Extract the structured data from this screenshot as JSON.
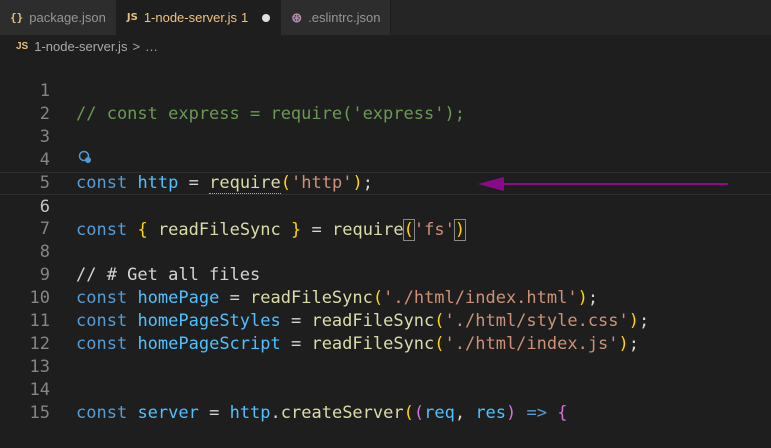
{
  "tabs": [
    {
      "icon": "{}",
      "label": "package.json"
    },
    {
      "icon": "JS",
      "label": "1-node-server.js",
      "error_count": "1"
    },
    {
      "icon": "⊛",
      "label": ".eslintrc.json"
    }
  ],
  "breadcrumb": {
    "icon": "JS",
    "file": "1-node-server.js",
    "sep": ">",
    "more": "…"
  },
  "lines": {
    "l1": {
      "num": "1",
      "comment": "// const express = require('express');"
    },
    "l2": {
      "num": "2"
    },
    "l3": {
      "num": "3"
    },
    "l4": {
      "num": "4",
      "kw": "const",
      "var": "http",
      "eq": " = ",
      "fn": "require",
      "open": "(",
      "str": "'http'",
      "close": ")",
      "end": ";"
    },
    "l5": {
      "num": "5"
    },
    "l6": {
      "num": "6",
      "kw": "const",
      "brace_open": "{",
      "name": "readFileSync",
      "brace_close": "}",
      "eq": " = ",
      "fn": "require",
      "open": "(",
      "str": "'fs'",
      "close": ")"
    },
    "l7": {
      "num": "7"
    },
    "l8": {
      "num": "8",
      "comment": "// # Get all files"
    },
    "l9": {
      "num": "9",
      "kw": "const",
      "var": "homePage",
      "eq": " = ",
      "fn": "readFileSync",
      "open": "(",
      "str": "'./html/index.html'",
      "close": ")",
      "end": ";"
    },
    "l10": {
      "num": "10",
      "kw": "const",
      "var": "homePageStyles",
      "eq": " = ",
      "fn": "readFileSync",
      "open": "(",
      "str": "'./html/style.css'",
      "close": ")",
      "end": ";"
    },
    "l11": {
      "num": "11",
      "kw": "const",
      "var": "homePageScript",
      "eq": " = ",
      "fn": "readFileSync",
      "open": "(",
      "str": "'./html/index.js'",
      "close": ")",
      "end": ";"
    },
    "l12": {
      "num": "12"
    },
    "l13": {
      "num": "13"
    },
    "l14": {
      "num": "14",
      "kw": "const",
      "var": "server",
      "eq": " = ",
      "obj": "http",
      "dot": ".",
      "fn": "createServer",
      "open": "(",
      "open2": "(",
      "arg1": "req",
      "comma": ", ",
      "arg2": "res",
      "close2": ")",
      "arrow": " => ",
      "brace": "{"
    },
    "l15": {
      "num": "15"
    }
  },
  "colors": {
    "arrow": "#8b0a8b",
    "keyword": "#569cd6",
    "string": "#ce9178",
    "function": "#dcdcaa",
    "comment": "#6a9955"
  }
}
